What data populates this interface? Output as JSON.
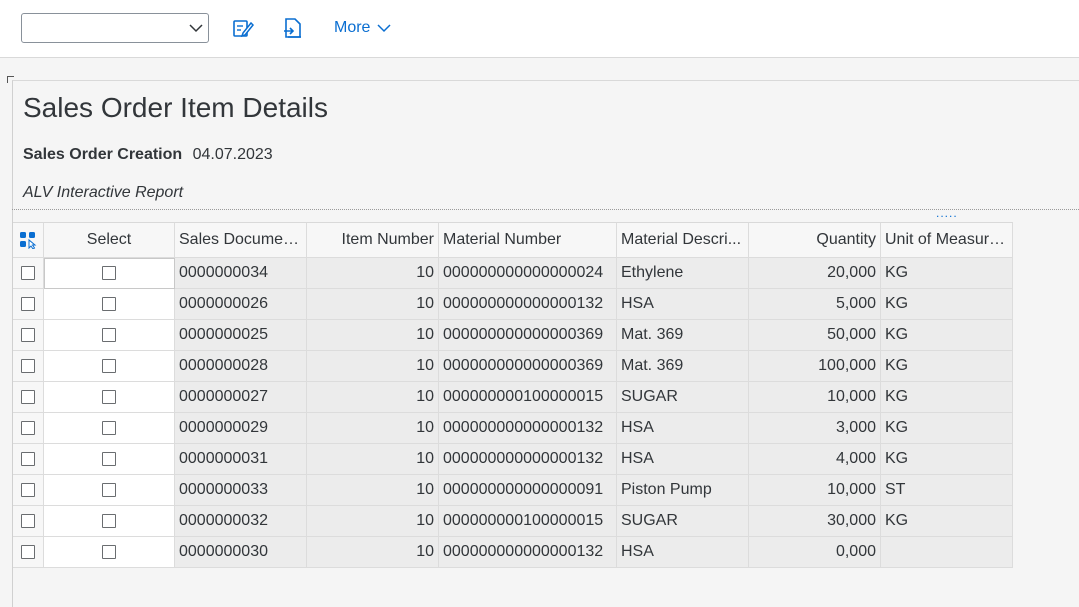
{
  "toolbar": {
    "dropdown_value": "",
    "icon1": "edit-icon",
    "icon2": "export-icon",
    "more_label": "More"
  },
  "page": {
    "title": "Sales Order Item Details",
    "subtitle_label": "Sales Order Creation",
    "subtitle_value": "04.07.2023",
    "report_name": "ALV Interactive Report"
  },
  "table": {
    "headers": [
      "Select",
      "Sales Documen...",
      "Item Number",
      "Material Number",
      "Material Descri...",
      "Quantity",
      "Unit of Measure..."
    ],
    "rows": [
      [
        "0000000034",
        "10",
        "000000000000000024",
        "Ethylene",
        "20,000",
        "KG"
      ],
      [
        "0000000026",
        "10",
        "000000000000000132",
        "HSA",
        "5,000",
        "KG"
      ],
      [
        "0000000025",
        "10",
        "000000000000000369",
        "Mat. 369",
        "50,000",
        "KG"
      ],
      [
        "0000000028",
        "10",
        "000000000000000369",
        "Mat. 369",
        "100,000",
        "KG"
      ],
      [
        "0000000027",
        "10",
        "000000000100000015",
        "SUGAR",
        "10,000",
        "KG"
      ],
      [
        "0000000029",
        "10",
        "000000000000000132",
        "HSA",
        "3,000",
        "KG"
      ],
      [
        "0000000031",
        "10",
        "000000000000000132",
        "HSA",
        "4,000",
        "KG"
      ],
      [
        "0000000033",
        "10",
        "000000000000000091",
        "Piston Pump",
        "10,000",
        "ST"
      ],
      [
        "0000000032",
        "10",
        "000000000100000015",
        "SUGAR",
        "30,000",
        "KG"
      ],
      [
        "0000000030",
        "10",
        "000000000000000132",
        "HSA",
        "0,000",
        ""
      ]
    ]
  },
  "colors": {
    "accent": "#0a6ed1",
    "grid_bg": "#ececec"
  }
}
